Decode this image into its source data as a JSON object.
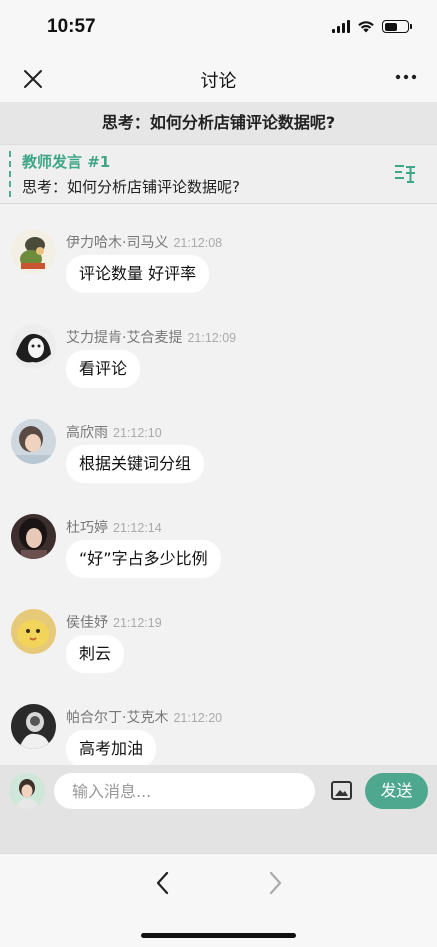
{
  "status": {
    "time": "10:57",
    "battery_level": 0.55
  },
  "nav": {
    "title": "讨论",
    "close_icon": "close-icon",
    "more_icon": "more-icon"
  },
  "topic": {
    "text": "思考：如何分析店铺评论数据呢?"
  },
  "teacher": {
    "label": "教师发言 #1",
    "text": "思考：如何分析店铺评论数据呢?",
    "accent": "#3fa687"
  },
  "messages": [
    {
      "name": "伊力哈木·司马义",
      "time": "21:12:08",
      "text": "评论数量 好评率"
    },
    {
      "name": "艾力提肯·艾合麦提",
      "time": "21:12:09",
      "text": "看评论"
    },
    {
      "name": "高欣雨",
      "time": "21:12:10",
      "text": "根据关键词分组"
    },
    {
      "name": "杜巧婷",
      "time": "21:12:14",
      "text": "“好”字占多少比例"
    },
    {
      "name": "侯佳妤",
      "time": "21:12:19",
      "text": "刺云"
    },
    {
      "name": "帕合尔丁·艾克木",
      "time": "21:12:20",
      "text": "高考加油"
    }
  ],
  "input": {
    "placeholder": "输入消息...",
    "send_label": "发送",
    "send_color": "#4ea88f"
  }
}
